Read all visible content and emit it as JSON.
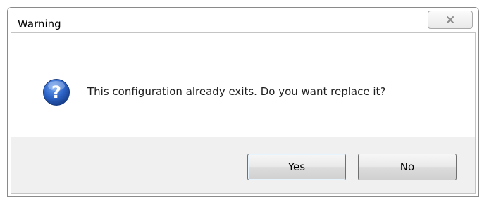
{
  "window": {
    "title": "Warning"
  },
  "message": {
    "text": "This configuration already exits. Do you want replace it?"
  },
  "buttons": {
    "yes_label": "Yes",
    "no_label": "No"
  },
  "icons": {
    "dialog_icon": "question-icon",
    "close_icon": "close-icon"
  },
  "colors": {
    "icon_blue": "#2c63c6",
    "button_strip": "#f0f0f0"
  }
}
